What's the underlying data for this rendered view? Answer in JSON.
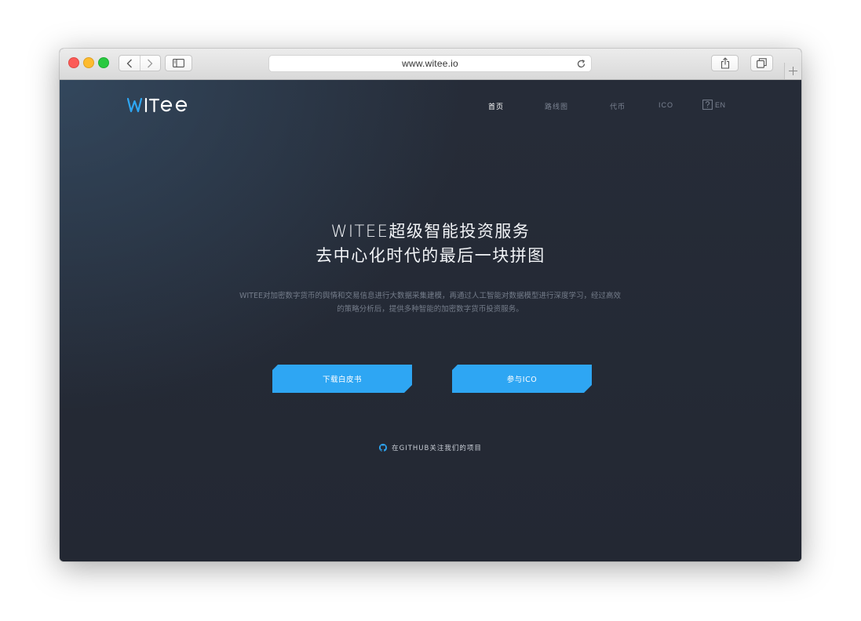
{
  "browser": {
    "url": "www.witee.io"
  },
  "brand": {
    "logo_text": "WITEE",
    "accent_color": "#2ea6f3"
  },
  "nav": {
    "items": [
      {
        "label": "首页",
        "active": true
      },
      {
        "label": "路线图",
        "active": false
      },
      {
        "label": "代币",
        "active": false
      },
      {
        "label": "ICO",
        "active": false
      }
    ],
    "lang_icon": "question-box-icon",
    "lang_label": "EN"
  },
  "hero": {
    "title_line1": "WITEE超级智能投资服务",
    "title_line2": "去中心化时代的最后一块拼图",
    "description_line1": "WITEE对加密数字货币的舆情和交易信息进行大数据采集建模，再通过人工智能对数据模型进行深度学习，经过高效",
    "description_line2": "的策略分析后，提供多种智能的加密数字货币投资服务。"
  },
  "buttons": {
    "whitepaper": "下载白皮书",
    "join_ico": "参与ICO"
  },
  "github": {
    "icon": "github-icon",
    "label": "在GITHUB关注我们的项目"
  }
}
